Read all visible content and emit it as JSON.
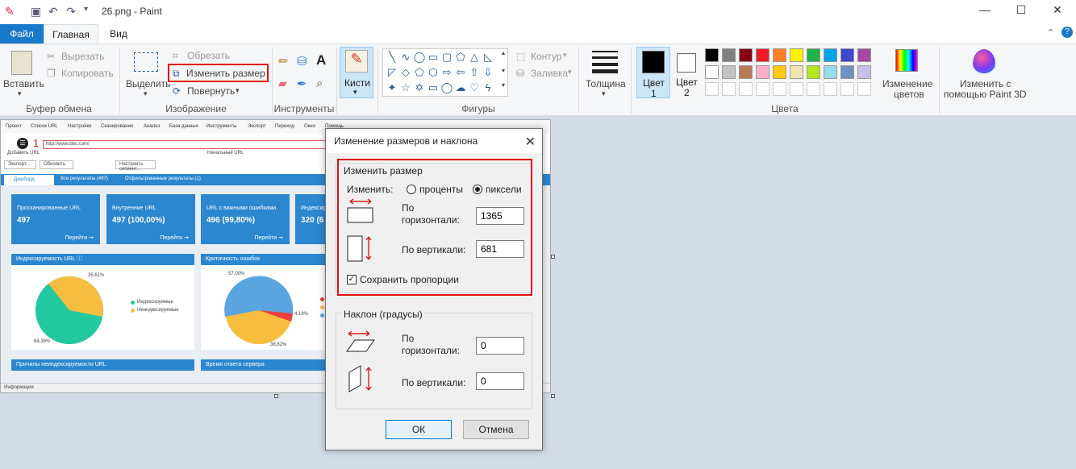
{
  "window": {
    "title": "26.png - Paint"
  },
  "tabs": [
    {
      "label": "Файл"
    },
    {
      "label": "Главная"
    },
    {
      "label": "Вид"
    }
  ],
  "ribbon": {
    "clipboard": {
      "paste": "Вставить",
      "cut": "Вырезать",
      "copy": "Копировать",
      "group": "Буфер обмена"
    },
    "image": {
      "select": "Выделить",
      "crop": "Обрезать",
      "resize": "Изменить размер",
      "rotate": "Повернуть",
      "group": "Изображение"
    },
    "tools": {
      "group": "Инструменты"
    },
    "brushes": {
      "label": "Кисти"
    },
    "shapes": {
      "outline": "Контур",
      "fill": "Заливка",
      "group": "Фигуры"
    },
    "size": {
      "label": "Толщина"
    },
    "colors": {
      "color1_label": "Цвет",
      "color1_num": "1",
      "color2_label": "Цвет",
      "color2_num": "2",
      "edit_line1": "Изменение",
      "edit_line2": "цветов",
      "group": "Цвета",
      "palette_row1": [
        "#000000",
        "#7f7f7f",
        "#880015",
        "#ed1c24",
        "#ff7f27",
        "#fff200",
        "#22b14c",
        "#00a2e8",
        "#3f48cc",
        "#a349a4"
      ],
      "palette_row2": [
        "#ffffff",
        "#c3c3c3",
        "#b97a57",
        "#ffaec9",
        "#ffc90e",
        "#efe4b0",
        "#b5e61d",
        "#99d9ea",
        "#7092be",
        "#c8bfe7"
      ]
    },
    "paint3d": {
      "line1": "Изменить с",
      "line2": "помощью Paint 3D"
    }
  },
  "canvas": {
    "menu": [
      "Проект",
      "Список URL",
      "Настройки",
      "Сканирование",
      "Анализ",
      "База данных",
      "Инструменты",
      "Экспорт",
      "Переход",
      "Окно",
      "Помощь"
    ],
    "url": "http://www.bbc.com/",
    "add_url": "Добавить URL",
    "start_url": "Начальный URL",
    "marker": "1",
    "export_btn": "Экспорт...",
    "refresh_btn": "Обновить",
    "segments_btn": "Настроить сегмент...",
    "subtabs": [
      "Дашборд",
      "Все результаты (497)",
      "Отфильтрованные результаты (1)"
    ],
    "tiles": [
      {
        "label": "Просканированные URL",
        "value": "497",
        "link": "Перейти ➞"
      },
      {
        "label": "Внутренние URL",
        "value": "497 (100,00%)",
        "link": "Перейти ➞"
      },
      {
        "label": "URL с важными ошибками",
        "value": "496 (99,80%)",
        "link": "Перейти ➞"
      },
      {
        "label": "Индексир",
        "value": "320 (6",
        "link": ""
      }
    ],
    "card1": {
      "title": "Индексируемость URL",
      "pct_a": "35,61%",
      "pct_b": "64,39%",
      "legend_a": "Индексируемые",
      "legend_b": "Неиндексируемые"
    },
    "card2": {
      "title": "Критичность ошибок",
      "pct_a": "57,00%",
      "pct_b": "4,18%",
      "pct_c": "38,82%"
    },
    "bar1": "Причины неиндексируемости URL",
    "bar2": "Время ответа сервера",
    "status": "Информация"
  },
  "dialog": {
    "title": "Изменение размеров и наклона",
    "close": "✕",
    "resize_group": "Изменить размер",
    "by_label": "Изменить:",
    "percent": "проценты",
    "pixels": "пиксели",
    "horizontal_l1": "По",
    "horizontal_l2": "горизонтали:",
    "horizontal_value": "1365",
    "vertical": "По вертикали:",
    "vertical_value": "681",
    "keep_ratio": "Сохранить пропорции",
    "skew_group": "Наклон (градусы)",
    "skew_h_value": "0",
    "skew_v_value": "0",
    "ok": "ОК",
    "cancel": "Отмена"
  }
}
